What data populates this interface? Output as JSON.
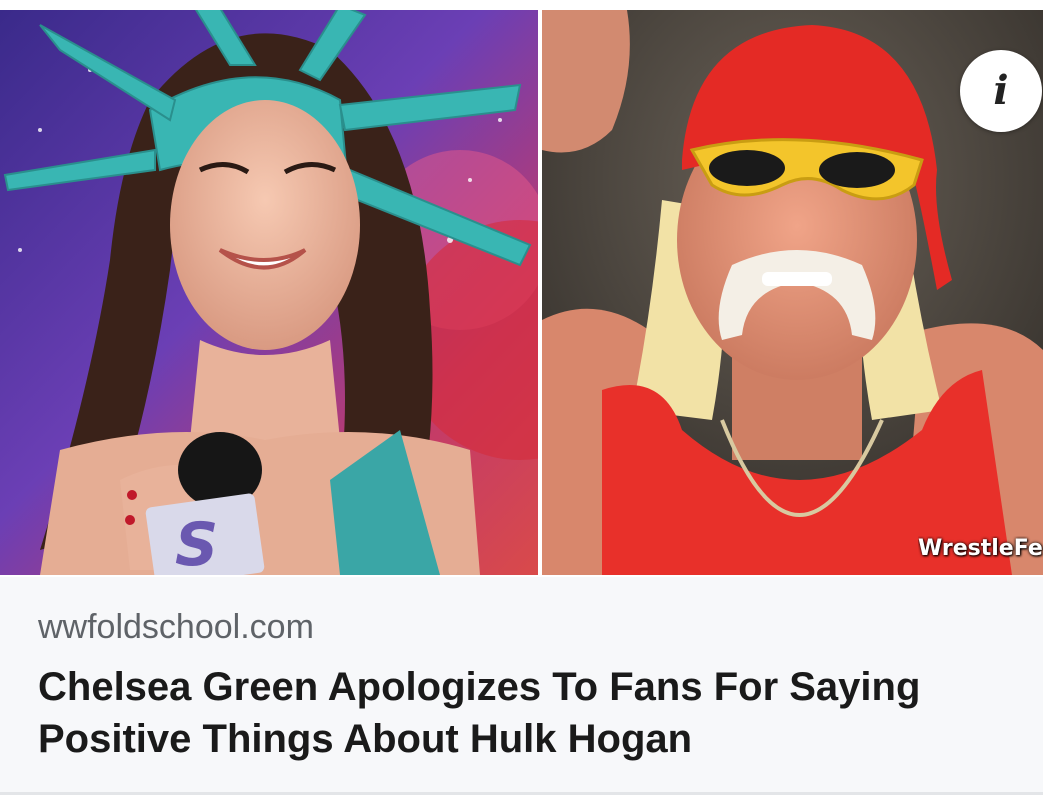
{
  "article": {
    "source": "wwfoldschool.com",
    "headline": "Chelsea Green Apologizes To Fans For Saying Positive Things About Hulk Hogan"
  },
  "media": {
    "watermark": "WrestleFe",
    "info_icon": "i"
  },
  "colors": {
    "card_background": "#f7f8fa",
    "source_text": "#5f6368",
    "headline_text": "#1a1a1a",
    "bandana_red": "#e42a25",
    "tank_top_red": "#e8302a",
    "crown_teal": "#39b6b3"
  }
}
